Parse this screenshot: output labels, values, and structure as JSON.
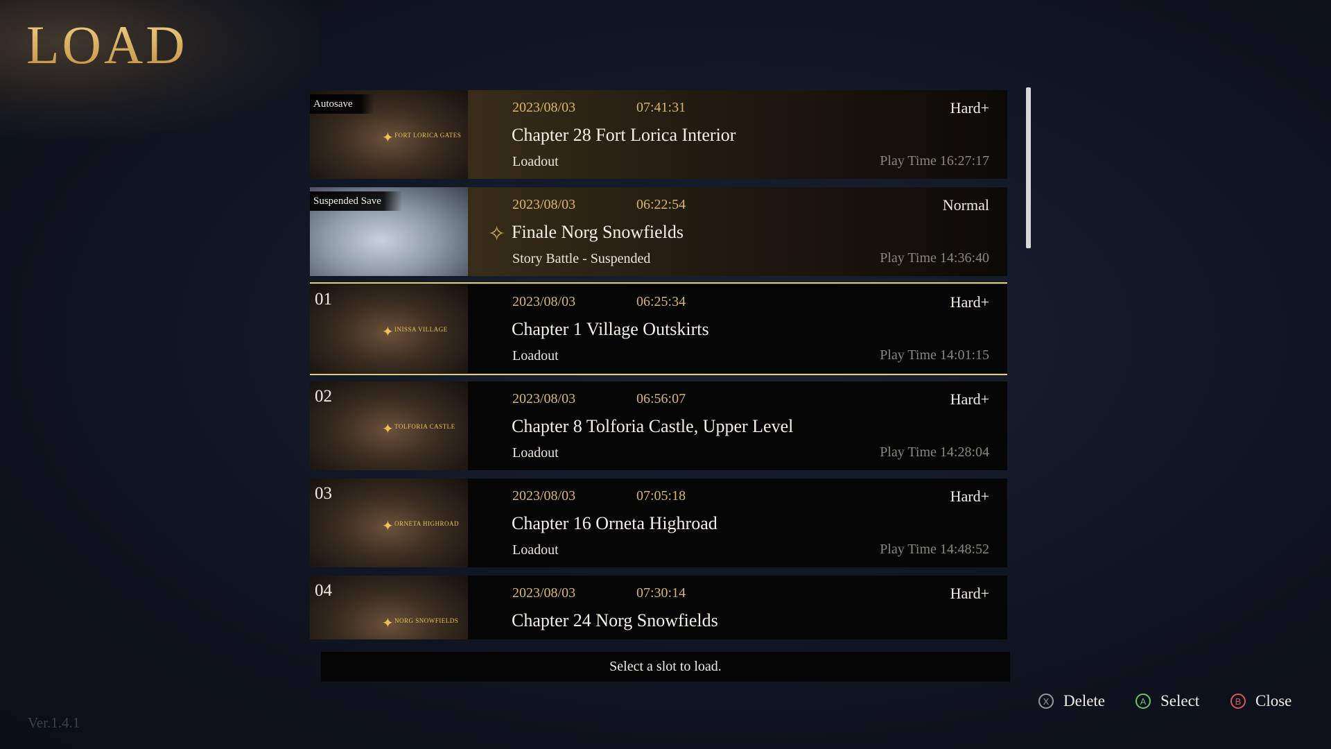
{
  "screen": {
    "title": "LOAD",
    "version": "Ver.1.4.1"
  },
  "slots": [
    {
      "tag": "Autosave",
      "number": "",
      "location_label": "Fort Lorica Gates",
      "date": "2023/08/03",
      "time": "07:41:31",
      "difficulty": "Hard+",
      "chapter": "Chapter 28 Fort Lorica Interior",
      "mode": "Loadout",
      "playtime": "Play Time 16:27:17"
    },
    {
      "tag": "Suspended Save",
      "number": "",
      "location_label": "",
      "date": "2023/08/03",
      "time": "06:22:54",
      "difficulty": "Normal",
      "chapter": "Finale Norg Snowfields",
      "mode": "Story Battle - Suspended",
      "playtime": "Play Time 14:36:40"
    },
    {
      "tag": "",
      "number": "01",
      "location_label": "Inissa Village",
      "date": "2023/08/03",
      "time": "06:25:34",
      "difficulty": "Hard+",
      "chapter": "Chapter 1 Village Outskirts",
      "mode": "Loadout",
      "playtime": "Play Time 14:01:15"
    },
    {
      "tag": "",
      "number": "02",
      "location_label": "Tolforia Castle",
      "date": "2023/08/03",
      "time": "06:56:07",
      "difficulty": "Hard+",
      "chapter": "Chapter 8 Tolforia Castle, Upper Level",
      "mode": "Loadout",
      "playtime": "Play Time 14:28:04"
    },
    {
      "tag": "",
      "number": "03",
      "location_label": "Orneta Highroad",
      "date": "2023/08/03",
      "time": "07:05:18",
      "difficulty": "Hard+",
      "chapter": "Chapter 16 Orneta Highroad",
      "mode": "Loadout",
      "playtime": "Play Time 14:48:52"
    },
    {
      "tag": "",
      "number": "04",
      "location_label": "Norg Snowfields",
      "date": "2023/08/03",
      "time": "07:30:14",
      "difficulty": "Hard+",
      "chapter": "Chapter 24 Norg Snowfields",
      "mode": "",
      "playtime": ""
    }
  ],
  "hint": "Select a slot to load.",
  "controls": [
    {
      "key": "X",
      "label": "Delete",
      "color": "#9a9a9a"
    },
    {
      "key": "A",
      "label": "Select",
      "color": "#6fbf6a"
    },
    {
      "key": "B",
      "label": "Close",
      "color": "#d45a5a"
    }
  ],
  "icons": {
    "suspend": "star-marker-icon",
    "location": "location-marker-icon"
  }
}
